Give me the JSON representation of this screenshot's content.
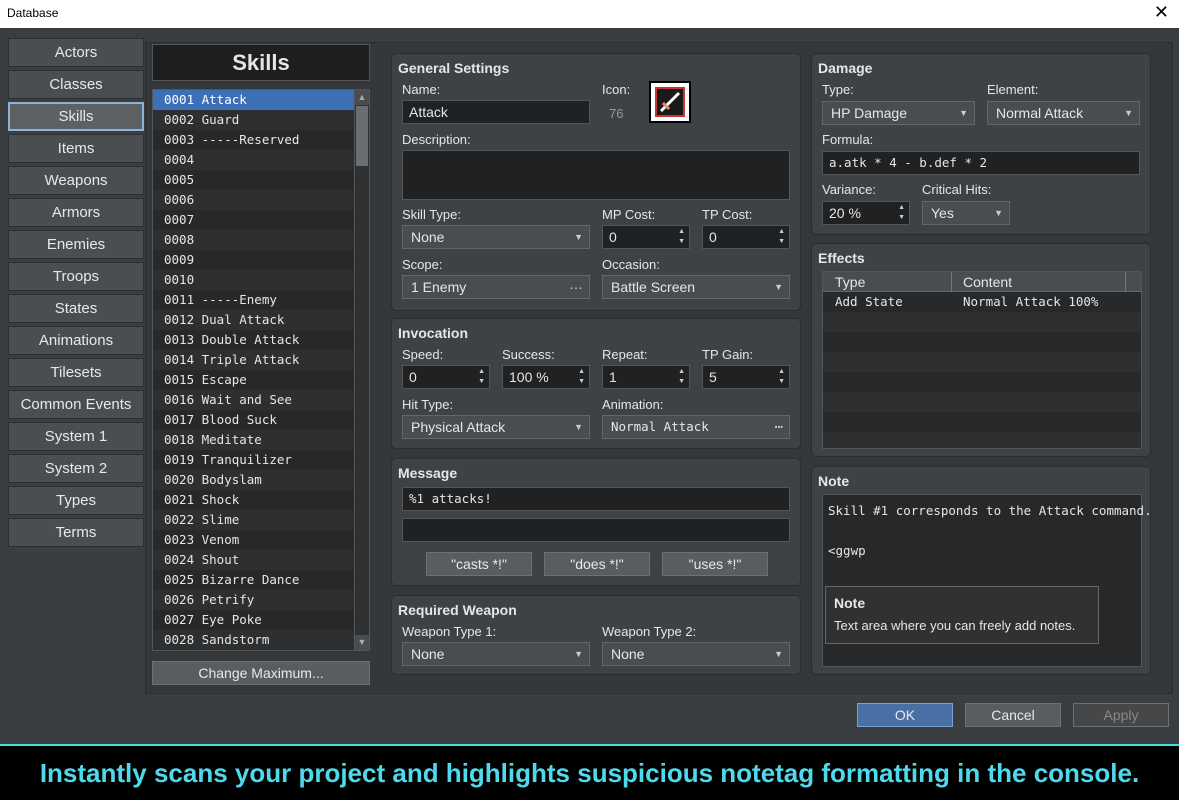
{
  "window": {
    "title": "Database"
  },
  "nav": [
    "Actors",
    "Classes",
    "Skills",
    "Items",
    "Weapons",
    "Armors",
    "Enemies",
    "Troops",
    "States",
    "Animations",
    "Tilesets",
    "Common Events",
    "System 1",
    "System 2",
    "Types",
    "Terms"
  ],
  "list": {
    "header": "Skills",
    "rows": [
      "0001 Attack",
      "0002 Guard",
      "0003 -----Reserved",
      "0004",
      "0005",
      "0006",
      "0007",
      "0008",
      "0009",
      "0010",
      "0011 -----Enemy",
      "0012 Dual Attack",
      "0013 Double Attack",
      "0014 Triple Attack",
      "0015 Escape",
      "0016 Wait and See",
      "0017 Blood Suck",
      "0018 Meditate",
      "0019 Tranquilizer",
      "0020 Bodyslam",
      "0021 Shock",
      "0022 Slime",
      "0023 Venom",
      "0024 Shout",
      "0025 Bizarre Dance",
      "0026 Petrify",
      "0027 Eye Poke",
      "0028 Sandstorm"
    ],
    "change_max": "Change Maximum..."
  },
  "general": {
    "title": "General Settings",
    "name_label": "Name:",
    "name": "Attack",
    "icon_label": "Icon:",
    "icon_index": "76",
    "desc_label": "Description:",
    "desc": "",
    "skilltype_label": "Skill Type:",
    "skilltype": "None",
    "mpcost_label": "MP Cost:",
    "mpcost": "0",
    "tpcost_label": "TP Cost:",
    "tpcost": "0",
    "scope_label": "Scope:",
    "scope": "1 Enemy",
    "occasion_label": "Occasion:",
    "occasion": "Battle Screen"
  },
  "invocation": {
    "title": "Invocation",
    "speed_label": "Speed:",
    "speed": "0",
    "success_label": "Success:",
    "success": "100 %",
    "repeat_label": "Repeat:",
    "repeat": "1",
    "tpgain_label": "TP Gain:",
    "tpgain": "5",
    "hittype_label": "Hit Type:",
    "hittype": "Physical Attack",
    "animation_label": "Animation:",
    "animation": "Normal Attack"
  },
  "message": {
    "title": "Message",
    "line1": "%1 attacks!",
    "line2": "",
    "btn1": "\"casts *!\"",
    "btn2": "\"does *!\"",
    "btn3": "\"uses *!\""
  },
  "weapon": {
    "title": "Required Weapon",
    "type1_label": "Weapon Type 1:",
    "type1": "None",
    "type2_label": "Weapon Type 2:",
    "type2": "None"
  },
  "damage": {
    "title": "Damage",
    "type_label": "Type:",
    "type": "HP Damage",
    "element_label": "Element:",
    "element": "Normal Attack",
    "formula_label": "Formula:",
    "formula": "a.atk * 4 - b.def * 2",
    "variance_label": "Variance:",
    "variance": "20 %",
    "critical_label": "Critical Hits:",
    "critical": "Yes"
  },
  "effects": {
    "title": "Effects",
    "col_type": "Type",
    "col_content": "Content",
    "rows": [
      {
        "type": "Add State",
        "content": "Normal Attack 100%"
      }
    ]
  },
  "note": {
    "title": "Note",
    "text": "Skill #1 corresponds to the Attack command.\n\n<ggwp",
    "tip_title": "Note",
    "tip_text": "Text area where you can freely add notes."
  },
  "buttons": {
    "ok": "OK",
    "cancel": "Cancel",
    "apply": "Apply"
  },
  "banner": "Instantly scans your project and highlights suspicious notetag formatting in the console."
}
